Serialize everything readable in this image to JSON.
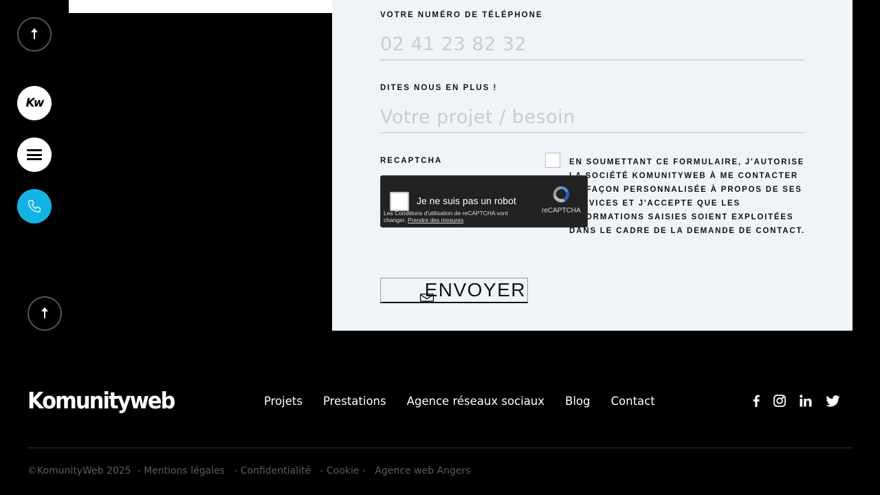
{
  "form": {
    "phone_label": "Votre numéro de téléphone",
    "phone_placeholder": "02 41 23 82 32",
    "details_label": "Dites nous en plus !",
    "details_placeholder": "Votre projet / besoin",
    "recaptcha_label": "Recaptcha",
    "consent_text": "En soumettant ce formulaire, j'autorise la société KomunityWeb à me contacter de façon personnalisée à propos de ses services et j'accepte que les informations saisies soient exploitées dans le cadre de la demande de contact.",
    "submit_label": "ENVOYER"
  },
  "recaptcha": {
    "checkbox_text": "Je ne suis pas un robot",
    "brand": "reCAPTCHA",
    "terms_text": "Les Conditions d'utilisation de reCAPTCHA vont changer. ",
    "terms_link": "Prendre des mesures"
  },
  "rail": {
    "logo_text": "Kw"
  },
  "footer": {
    "logo": "Komunityweb",
    "nav": [
      "Projets",
      "Prestations",
      "Agence réseaux sociaux",
      "Blog",
      "Contact"
    ],
    "legal": {
      "copyright": "©KomunityWeb 2025",
      "sep1": "  - ",
      "mentions": "Mentions légales",
      "sep2": "   - ",
      "privacy": "Confidentialité",
      "sep3": "   - ",
      "cookie": "Cookie",
      "sep4": " -   ",
      "agency": "Agence web Angers"
    }
  },
  "colors": {
    "accent": "#12b4e6",
    "panel_bg": "#f0f4f8",
    "background": "#000000"
  },
  "icons": {
    "scroll_top": "arrow-up-icon",
    "menu": "hamburger-icon",
    "phone": "phone-icon",
    "mail": "mail-icon",
    "socials": [
      "facebook-icon",
      "instagram-icon",
      "linkedin-icon",
      "twitter-icon"
    ]
  }
}
